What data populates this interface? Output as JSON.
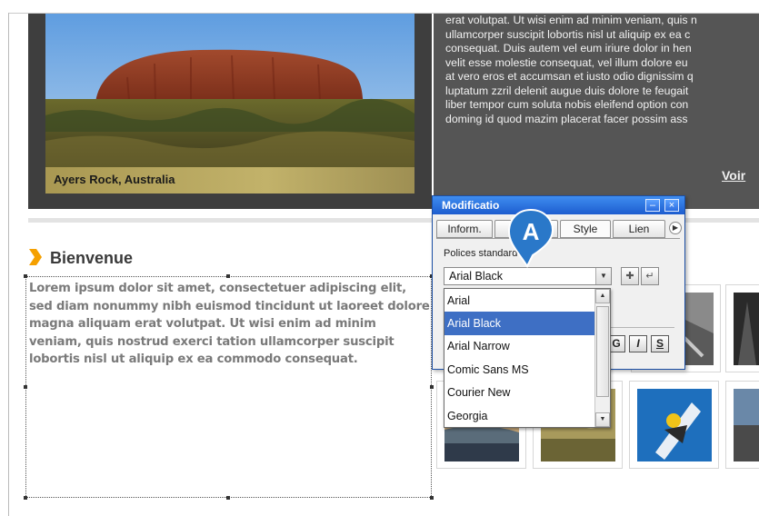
{
  "hero": {
    "caption": "Ayers Rock, Australia"
  },
  "article": {
    "lines": [
      "erat volutpat. Ut wisi enim ad minim veniam, quis n",
      "ullamcorper suscipit lobortis nisl ut aliquip ex ea c",
      "consequat. Duis autem vel eum iriure dolor in hen",
      "velit esse molestie consequat, vel illum dolore eu",
      "at vero eros et accumsan et iusto odio dignissim q",
      "luptatum zzril delenit augue duis dolore te feugait",
      "liber tempor cum soluta nobis eleifend option con",
      "doming id quod mazim placerat facer possim ass"
    ],
    "more_link": "Voir"
  },
  "welcome": {
    "title": "Bienvenue",
    "body": "Lorem ipsum dolor sit amet, consectetuer adipiscing elit, sed diam nonummy nibh euismod tincidunt ut laoreet dolore magna aliquam erat volutpat. Ut wisi enim ad minim veniam, quis nostrud exerci tation ullamcorper suscipit lobortis nisl ut aliquip ex ea commodo consequat."
  },
  "palette": {
    "title": "Modificatio",
    "tabs": [
      "Inform.",
      "",
      "Style",
      "Lien"
    ],
    "fonts_label": "Polices standard",
    "selected_font": "Arial Black",
    "font_options": [
      "Arial",
      "Arial Black",
      "Arial Narrow",
      "Comic Sans MS",
      "Courier New",
      "Georgia"
    ],
    "style_buttons": [
      "G",
      "I",
      "S"
    ],
    "minimize_icon": "minus-icon",
    "close_icon": "close-icon"
  },
  "marker": {
    "letter": "A"
  },
  "colors": {
    "accent_orange": "#f5a000",
    "selection_blue": "#3e6fc4",
    "titlebar_blue": "#1d5dcf"
  }
}
